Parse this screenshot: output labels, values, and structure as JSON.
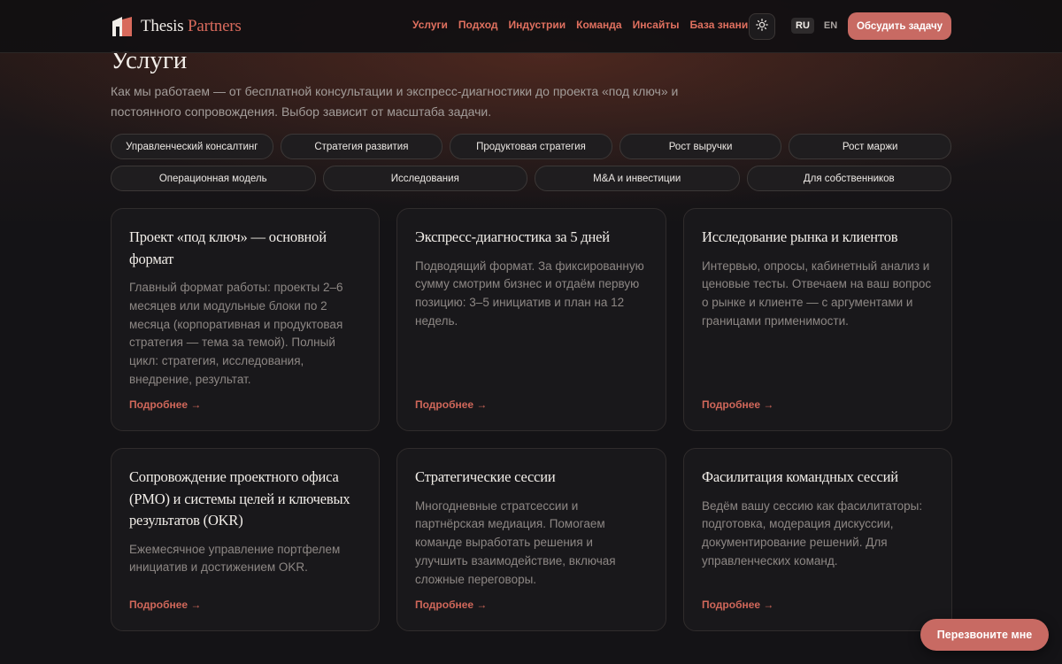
{
  "brand": {
    "name_part1": "Thesis",
    "name_part2": "Partners",
    "accent": "#d86a5c"
  },
  "nav": [
    {
      "label": "Услуги"
    },
    {
      "label": "Подход"
    },
    {
      "label": "Индустрии"
    },
    {
      "label": "Команда"
    },
    {
      "label": "Инсайты"
    },
    {
      "label": "База знаний"
    }
  ],
  "header": {
    "theme_icon": "sun-icon",
    "lang_active": "RU",
    "lang_other": "EN",
    "cta_label": "Обсудить задачу"
  },
  "main": {
    "title": "Услуги",
    "intro": "Как мы работаем — от бесплатной консультации и экспресс-диагностики до проекта «под ключ» и постоянного сопровождения. Выбор зависит от масштаба задачи."
  },
  "filters_row1": [
    {
      "label": "Управленческий консалтинг"
    },
    {
      "label": "Стратегия развития"
    },
    {
      "label": "Продуктовая стратегия"
    },
    {
      "label": "Рост выручки"
    },
    {
      "label": "Рост маржи"
    }
  ],
  "filters_row2": [
    {
      "label": "Операционная модель"
    },
    {
      "label": "Исследования"
    },
    {
      "label": "M&A и инвестиции"
    },
    {
      "label": "Для собственников"
    }
  ],
  "cards": [
    {
      "title": "Проект «под ключ» — основной формат",
      "desc": "Главный формат работы: проекты 2–6 месяцев или модульные блоки по 2 месяца (корпоративная и продуктовая стратегия — тема за темой). Полный цикл: стратегия, исследования, внедрение, результат.",
      "link": "Подробнее →"
    },
    {
      "title": "Экспресс-диагностика за 5 дней",
      "desc": "Подводящий формат. За фиксированную сумму смотрим бизнес и отдаём первую позицию: 3–5 инициатив и план на 12 недель.",
      "link": "Подробнее →"
    },
    {
      "title": "Исследование рынка и клиентов",
      "desc": "Интервью, опросы, кабинетный анализ и ценовые тесты. Отвечаем на ваш вопрос о рынке и клиенте — с аргументами и границами применимости.",
      "link": "Подробнее →"
    },
    {
      "title": "Сопровождение проектного офиса (PMO) и системы целей и ключевых результатов (OKR)",
      "desc": "Ежемесячное управление портфелем инициатив и достижением OKR.",
      "link": "Подробнее →"
    },
    {
      "title": "Стратегические сессии",
      "desc": "Многодневные стратсессии и партнёрская медиация. Помогаем команде выработать решения и улучшить взаимодействие, включая сложные переговоры.",
      "link": "Подробнее →"
    },
    {
      "title": "Фасилитация командных сессий",
      "desc": "Ведём вашу сессию как фасилитаторы: подготовка, модерация дискуссии, документирование решений. Для управленческих команд.",
      "link": "Подробнее →"
    }
  ],
  "callback": {
    "label": "Перезвоните мне"
  },
  "colors": {
    "background": "#141316",
    "accent": "#c86a63",
    "nav_link": "#e0705f"
  }
}
